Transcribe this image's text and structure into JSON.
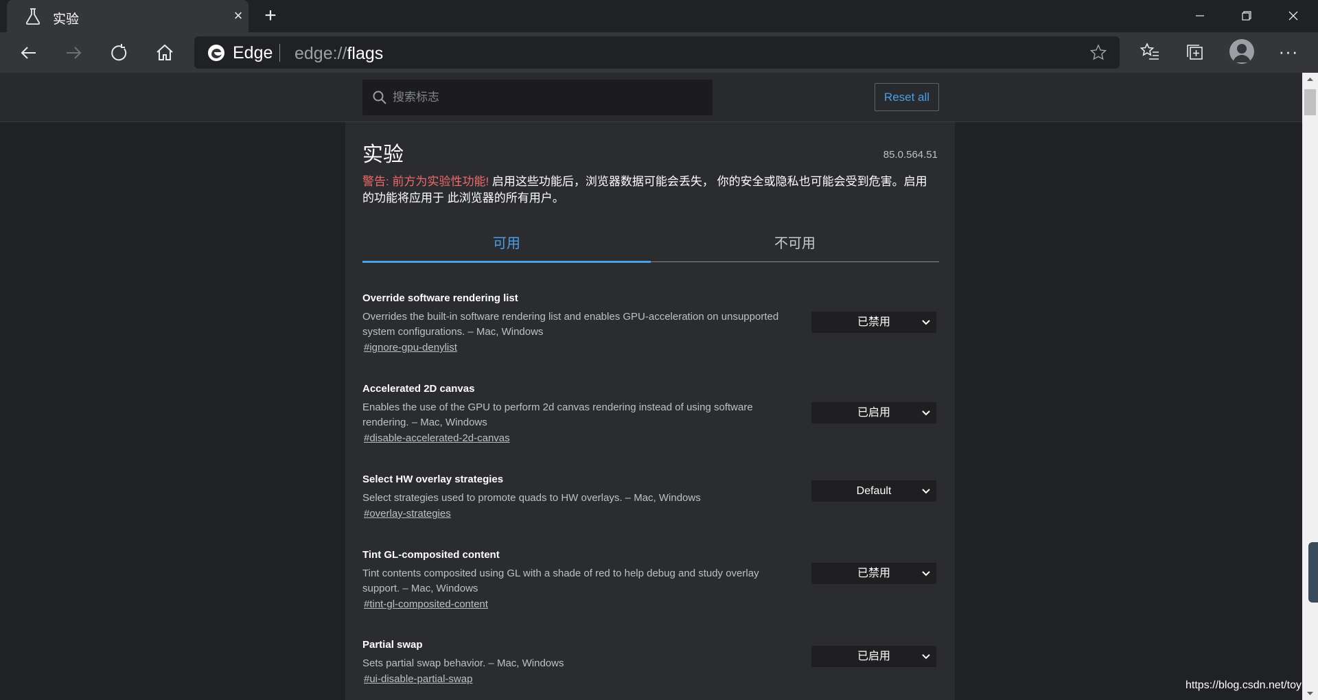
{
  "browser": {
    "tab": {
      "title": "实验"
    },
    "window_controls": {
      "minimize": "—",
      "restore": "❐",
      "close": "✕"
    },
    "address": {
      "brand": "Edge",
      "url_prefix": "edge://",
      "url_host": "flags"
    },
    "colors": {
      "accent": "#4a9fe8",
      "warning": "#ef6a6a",
      "background": "#202124",
      "panel": "#2b2c2f"
    }
  },
  "header": {
    "search_placeholder": "搜索标志",
    "reset_label": "Reset all"
  },
  "main": {
    "title": "实验",
    "version": "85.0.564.51",
    "warning_prefix": "警告: 前方为实验性功能!",
    "warning_text": " 启用这些功能后，浏览器数据可能会丢失， 你的安全或隐私也可能会受到危害。启用的功能将应用于 此浏览器的所有用户。",
    "tabs": [
      {
        "label": "可用",
        "active": true
      },
      {
        "label": "不可用",
        "active": false
      }
    ],
    "flags": [
      {
        "name": "Override software rendering list",
        "description": "Overrides the built-in software rendering list and enables GPU-acceleration on unsupported system configurations. – Mac, Windows",
        "link": "#ignore-gpu-denylist",
        "value": "已禁用"
      },
      {
        "name": "Accelerated 2D canvas",
        "description": "Enables the use of the GPU to perform 2d canvas rendering instead of using software rendering. – Mac, Windows",
        "link": "#disable-accelerated-2d-canvas",
        "value": "已启用"
      },
      {
        "name": "Select HW overlay strategies",
        "description": "Select strategies used to promote quads to HW overlays. – Mac, Windows",
        "link": "#overlay-strategies",
        "value": "Default"
      },
      {
        "name": "Tint GL-composited content",
        "description": "Tint contents composited using GL with a shade of red to help debug and study overlay support. – Mac, Windows",
        "link": "#tint-gl-composited-content",
        "value": "已禁用"
      },
      {
        "name": "Partial swap",
        "description": "Sets partial swap behavior. – Mac, Windows",
        "link": "#ui-disable-partial-swap",
        "value": "已启用"
      }
    ]
  },
  "watermark": "https://blog.csdn.net/toy"
}
